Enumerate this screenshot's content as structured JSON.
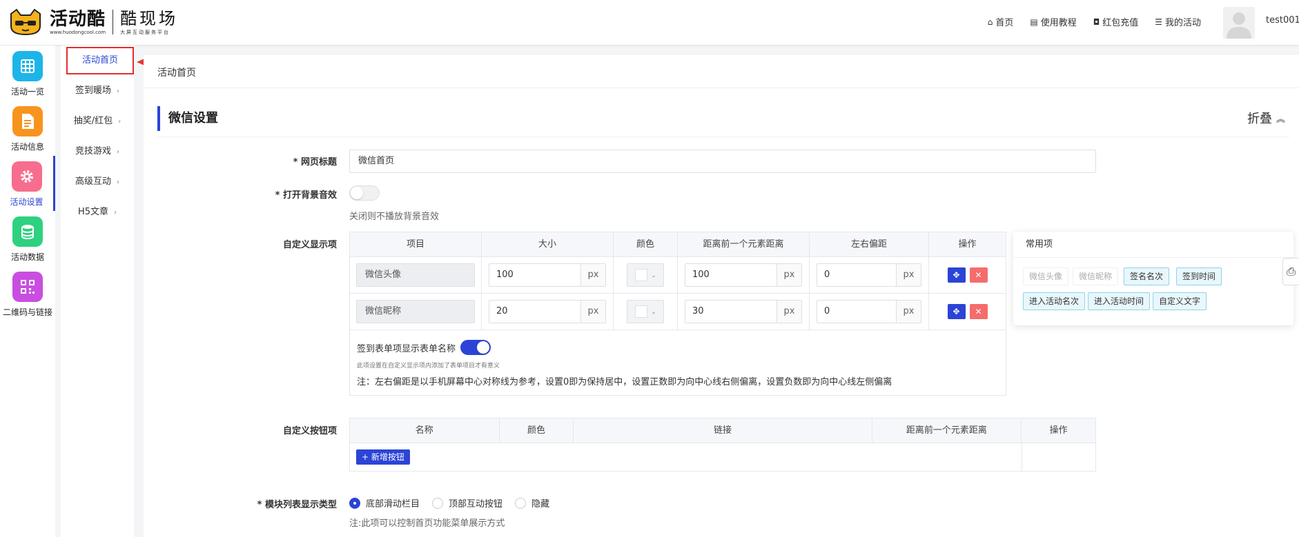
{
  "header": {
    "logo_name": "活动酷",
    "logo_url": "www.huodongcool.com",
    "logo_sub_name": "酷现场",
    "logo_sub_desc": "大屏互动服务平台",
    "nav": [
      {
        "label": "首页",
        "icon": "home-icon"
      },
      {
        "label": "使用教程",
        "icon": "book-icon"
      },
      {
        "label": "红包充值",
        "icon": "wallet-icon"
      },
      {
        "label": "我的活动",
        "icon": "list-icon"
      }
    ],
    "username": "test001"
  },
  "iconbar": [
    {
      "label": "活动一览",
      "icon": "grid-icon",
      "color": "#1db5e8"
    },
    {
      "label": "活动信息",
      "icon": "document-icon",
      "color": "#f7941d"
    },
    {
      "label": "活动设置",
      "icon": "gear-icon",
      "color": "#f76d8e"
    },
    {
      "label": "活动数据",
      "icon": "database-icon",
      "color": "#2dd17f"
    },
    {
      "label": "二维码与链接",
      "icon": "qrcode-icon",
      "color": "#c94ee0"
    }
  ],
  "submenu": [
    {
      "label": "活动首页",
      "active": true
    },
    {
      "label": "签到暖场"
    },
    {
      "label": "抽奖/红包"
    },
    {
      "label": "竞技游戏"
    },
    {
      "label": "高级互动"
    },
    {
      "label": "H5文章"
    }
  ],
  "breadcrumb": "活动首页",
  "section": {
    "title": "微信设置",
    "fold_label": "折叠"
  },
  "form": {
    "page_title_label": "* 网页标题",
    "page_title_value": "微信首页",
    "bg_sound_label": "* 打开背景音效",
    "bg_sound_hint": "关闭则不播放背景音效",
    "custom_display_label": "自定义显示项",
    "custom_buttons_label": "自定义按钮项",
    "module_display_label": "* 模块列表显示类型",
    "module_display_hint": "注:此项可以控制首页功能菜单展示方式"
  },
  "display_table": {
    "headers": [
      "项目",
      "大小",
      "颜色",
      "距离前一个元素距离",
      "左右偏距",
      "操作"
    ],
    "rows": [
      {
        "item": "微信头像",
        "size": "100",
        "unit": "px",
        "distance": "100",
        "offset": "0"
      },
      {
        "item": "微信昵称",
        "size": "20",
        "unit": "px",
        "distance": "30",
        "offset": "0"
      }
    ],
    "form_name_label": "签到表单项显示表单名称",
    "form_name_small": "此项设置在自定义显示项内添加了表单项目才有意义",
    "note": "注：左右偏距是以手机屏幕中心对称线为参考，设置0即为保持居中，设置正数即为向中心线右侧偏离，设置负数即为向中心线左侧偏离"
  },
  "common_items": {
    "title": "常用项",
    "chips": [
      {
        "label": "微信头像",
        "disabled": true
      },
      {
        "label": "微信昵称",
        "disabled": true
      },
      {
        "label": "签名名次",
        "disabled": false
      },
      {
        "label": "签到时间",
        "disabled": false
      },
      {
        "label": "进入活动名次",
        "disabled": false
      },
      {
        "label": "进入活动时间",
        "disabled": false
      },
      {
        "label": "自定义文字",
        "disabled": false
      }
    ]
  },
  "buttons_table": {
    "headers": [
      "名称",
      "颜色",
      "链接",
      "距离前一个元素距离",
      "操作"
    ],
    "add_button": "+ 新增按钮"
  },
  "module_options": [
    {
      "label": "底部滑动栏目",
      "selected": true
    },
    {
      "label": "顶部互动按钮",
      "selected": false
    },
    {
      "label": "隐藏",
      "selected": false
    }
  ],
  "colors": {
    "accent": "#2b44d6",
    "danger": "#f56c6c",
    "highlight_border": "#e02e2e"
  }
}
